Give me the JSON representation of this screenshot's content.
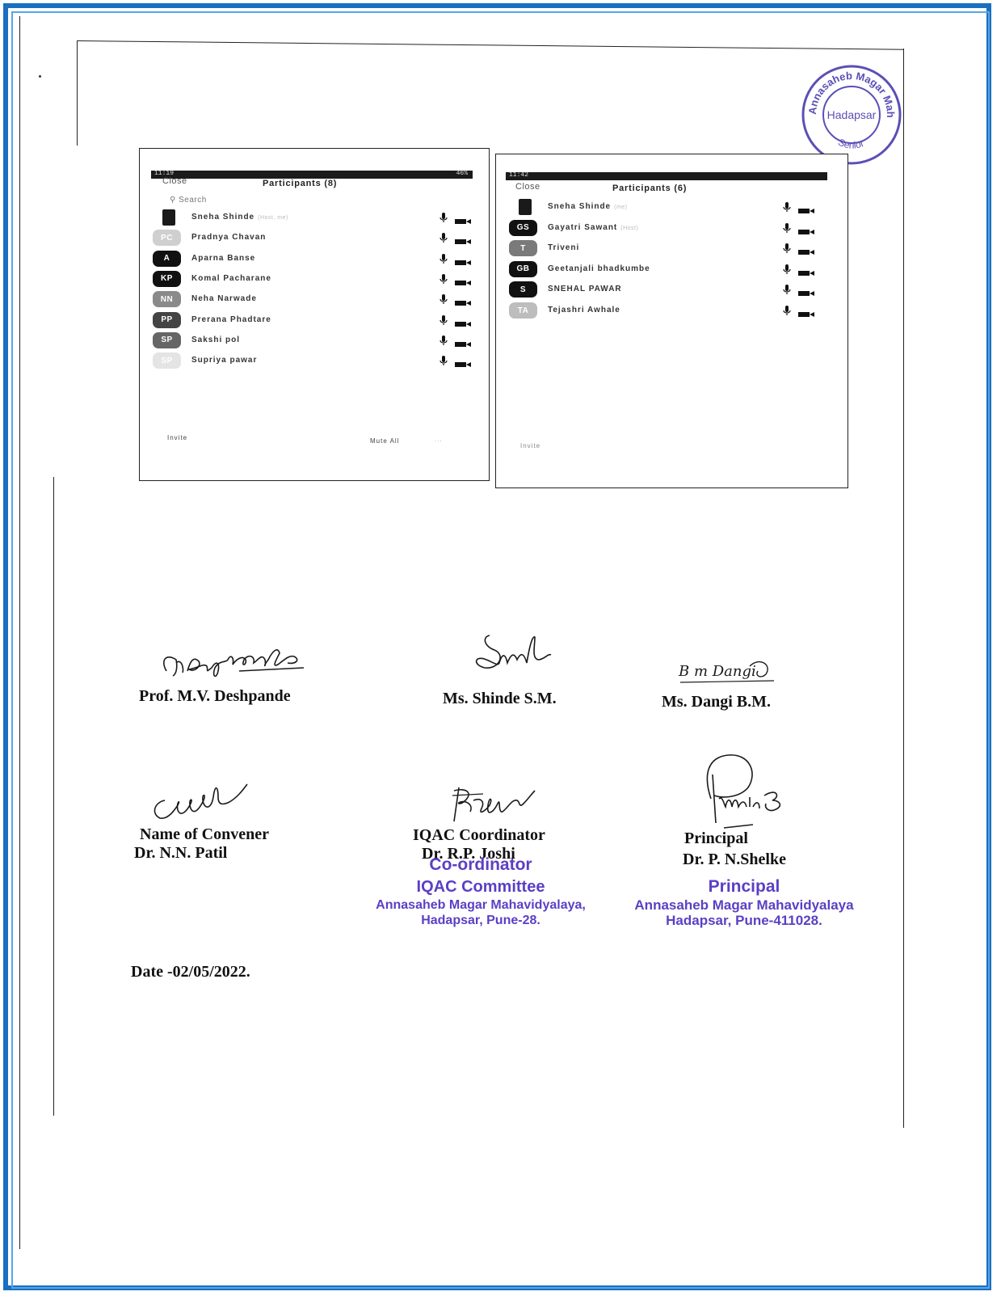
{
  "stamp": {
    "top_text": "Annasaheb Magar Mahavidyalaya",
    "center_text": "Hadapsar",
    "bottom_text": "Senior"
  },
  "screenshots": [
    {
      "status_time": "11:19",
      "status_right": "46%",
      "close_label": "Close",
      "title": "Participants (8)",
      "search_placeholder": "Search",
      "participants": [
        {
          "initials": "",
          "name": "Sneha Shinde",
          "tag": "(Host, me)",
          "avatar_color": "#1a1a1a",
          "photo": true
        },
        {
          "initials": "PC",
          "name": "Pradnya Chavan",
          "tag": "",
          "avatar_color": "#cfcfcf",
          "photo": false
        },
        {
          "initials": "A",
          "name": "Aparna Banse",
          "tag": "",
          "avatar_color": "#111111",
          "photo": false
        },
        {
          "initials": "KP",
          "name": "Komal Pacharane",
          "tag": "",
          "avatar_color": "#111111",
          "photo": false
        },
        {
          "initials": "NN",
          "name": "Neha Narwade",
          "tag": "",
          "avatar_color": "#8a8a8a",
          "photo": false
        },
        {
          "initials": "PP",
          "name": "Prerana Phadtare",
          "tag": "",
          "avatar_color": "#444444",
          "photo": false
        },
        {
          "initials": "SP",
          "name": "Sakshi pol",
          "tag": "",
          "avatar_color": "#666666",
          "photo": false
        },
        {
          "initials": "SP",
          "name": "Supriya pawar",
          "tag": "",
          "avatar_color": "#e4e4e4",
          "photo": false
        }
      ],
      "invite_label": "Invite",
      "mute_all_label": "Mute All",
      "more_label": "..."
    },
    {
      "status_time": "11:42",
      "status_right": "",
      "close_label": "Close",
      "title": "Participants (6)",
      "participants": [
        {
          "initials": "",
          "name": "Sneha Shinde",
          "tag": "(me)",
          "avatar_color": "#1a1a1a",
          "photo": true
        },
        {
          "initials": "GS",
          "name": "Gayatri Sawant",
          "tag": "(Host)",
          "avatar_color": "#111111",
          "photo": false
        },
        {
          "initials": "T",
          "name": "Triveni",
          "tag": "",
          "avatar_color": "#7a7a7a",
          "photo": false
        },
        {
          "initials": "GB",
          "name": "Geetanjali bhadkumbe",
          "tag": "",
          "avatar_color": "#111111",
          "photo": false
        },
        {
          "initials": "S",
          "name": "SNEHAL PAWAR",
          "tag": "",
          "avatar_color": "#111111",
          "photo": false
        },
        {
          "initials": "TA",
          "name": "Tejashri Awhale",
          "tag": "",
          "avatar_color": "#bdbdbd",
          "photo": false
        }
      ],
      "invite_label": "Invite"
    }
  ],
  "signatories": {
    "deshpande": {
      "signature": "mDeshpande",
      "name": "Prof. M.V. Deshpande"
    },
    "shinde": {
      "signature": "SMS",
      "name": "Ms. Shinde S.M."
    },
    "dangi": {
      "signature": "B M Dangi",
      "name": "Ms. Dangi B.M."
    },
    "convener": {
      "role": "Name of Convener",
      "name": "Dr. N.N. Patil"
    },
    "iqac": {
      "role": "IQAC Coordinator",
      "name": "Dr. R.P. Joshi"
    },
    "principal": {
      "role": "Principal",
      "name": "Dr. P. N.Shelke"
    }
  },
  "stamp_iqac": {
    "line1": "Co-ordinator",
    "line2": "IQAC Committee",
    "line3": "Annasaheb Magar Mahavidyalaya,",
    "line4": "Hadapsar, Pune-28."
  },
  "stamp_principal": {
    "line1": "Principal",
    "line2": "Annasaheb Magar Mahavidyalaya",
    "line3": "Hadapsar, Pune-411028."
  },
  "date": "Date -02/05/2022."
}
